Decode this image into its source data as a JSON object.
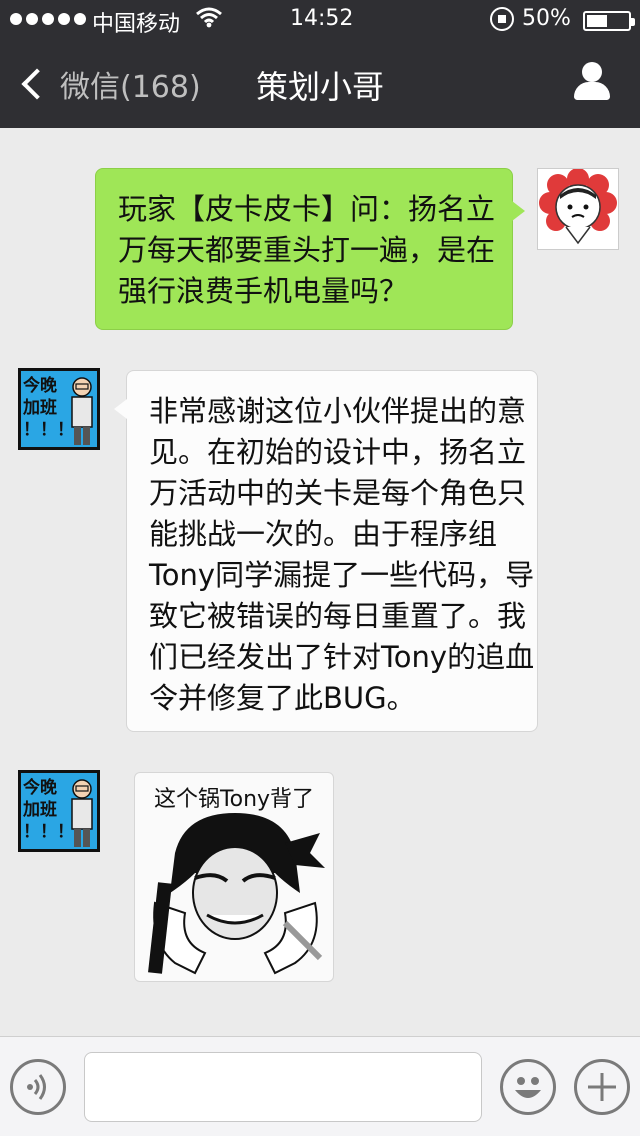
{
  "status_bar": {
    "carrier": "中国移动",
    "time": "14:52",
    "battery": "50%",
    "battery_level": 0.5,
    "icons": [
      "signal-dots-icon",
      "wifi-icon",
      "rotation-lock-icon",
      "battery-icon"
    ]
  },
  "nav": {
    "back_label": "微信(168)",
    "title": "策划小哥",
    "icons": [
      "back-chevron-icon",
      "profile-icon"
    ]
  },
  "messages": [
    {
      "sender": "me",
      "lines": [
        "玩家【皮卡皮卡】问：扬名立",
        "万每天都要重头打一遍，是在",
        "强行浪费手机电量吗？"
      ]
    },
    {
      "sender": "them",
      "avatar_text": [
        "今晚",
        "加班",
        "！！！"
      ],
      "lines": [
        "非常感谢这位小伙伴提出的意",
        "见。在初始的设计中，扬名立",
        "万活动中的关卡是每个角色只",
        "能挑战一次的。由于程序组",
        "Tony同学漏提了一些代码，导",
        "致它被错误的每日重置了。我",
        "们已经发出了针对Tony的追血",
        "令并修复了此BUG。"
      ]
    },
    {
      "sender": "them",
      "avatar_text": [
        "今晚",
        "加班",
        "！！！"
      ],
      "sticker_caption": "这个锅Tony背了"
    }
  ],
  "input_bar": {
    "value": "",
    "placeholder": "",
    "icons": [
      "voice-icon",
      "emoji-icon",
      "plus-icon"
    ]
  },
  "colors": {
    "nav_bg": "#2f2f33",
    "chat_bg": "#ebebeb",
    "my_bubble": "#9fe657",
    "their_bubble": "#fcfcfc",
    "tony_avatar_bg": "#2aa6e4"
  }
}
